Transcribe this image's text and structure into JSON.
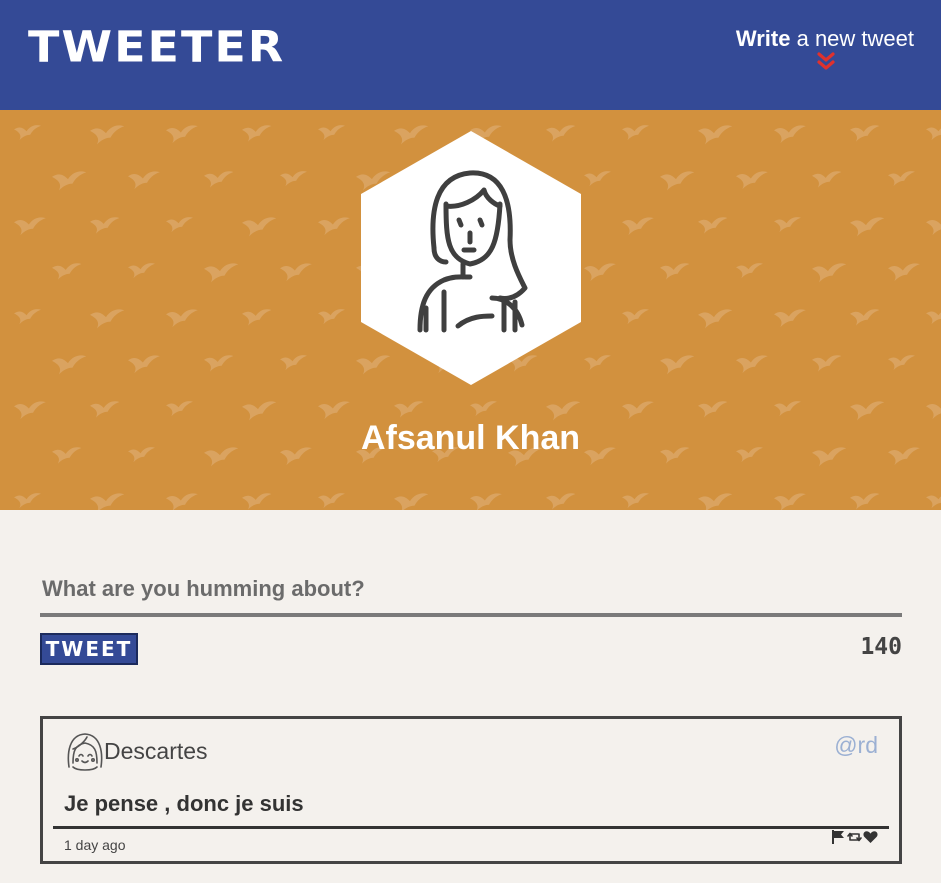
{
  "nav": {
    "brand": "TWEETER",
    "compose_strong": "Write",
    "compose_rest": " a new tweet",
    "compose_icon": "double-chevron-down-icon"
  },
  "colors": {
    "nav_bg": "#344a96",
    "banner_bg": "#d2913e",
    "page_bg": "#f4f1ed",
    "chevron": "#e0312d",
    "handle": "#9bb0d3"
  },
  "profile": {
    "name": "Afsanul Khan",
    "avatar_icon": "woman-avatar-icon"
  },
  "composer": {
    "placeholder": "What are you humming about?",
    "value": "",
    "submit_label": "TWEET",
    "char_count": "140"
  },
  "tweets": [
    {
      "author": "Descartes",
      "handle": "@rd",
      "content": "Je pense , donc je suis",
      "time": "1 day ago",
      "actions": [
        "flag-icon",
        "retweet-icon",
        "heart-icon"
      ]
    }
  ]
}
